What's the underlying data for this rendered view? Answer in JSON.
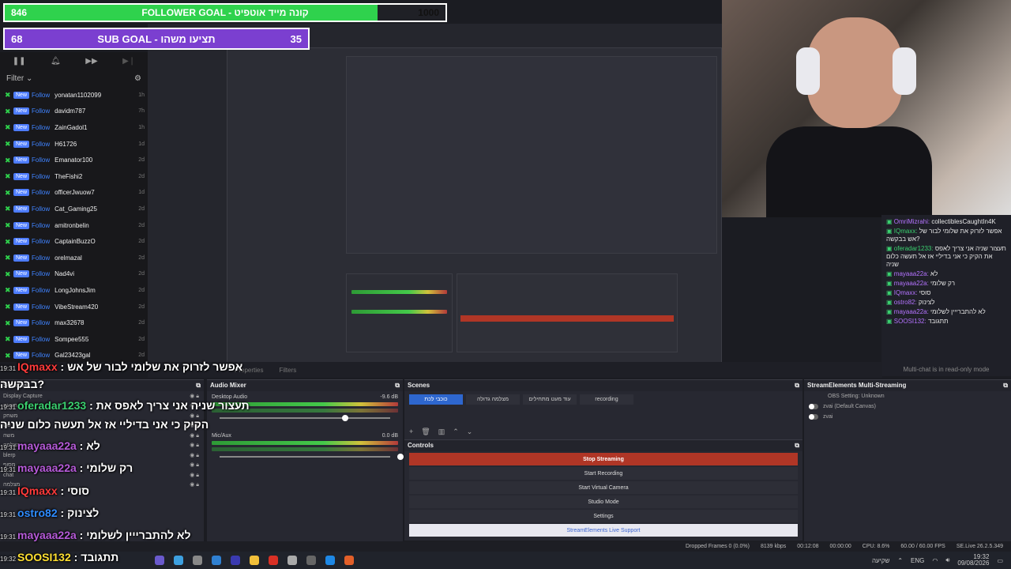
{
  "goals": {
    "follower": {
      "current": "846",
      "title": "FOLLOWER GOAL - קונה מייד אוטפיט",
      "target": "1000",
      "progress": 0.846
    },
    "sub": {
      "current": "68",
      "title": "SUB GOAL - תציעו משהו",
      "target": "35"
    }
  },
  "feed": {
    "filter_label": "Filter",
    "new_label": "New",
    "follow_label": "Follow",
    "rows": [
      {
        "name": "yonatan1102099",
        "age": "1h"
      },
      {
        "name": "davidm787",
        "age": "7h"
      },
      {
        "name": "ZainGadol1",
        "age": "1h"
      },
      {
        "name": "H61726",
        "age": "1d"
      },
      {
        "name": "Emanator100",
        "age": "2d"
      },
      {
        "name": "TheFishi2",
        "age": "2d"
      },
      {
        "name": "officerJwuow7",
        "age": "1d"
      },
      {
        "name": "Cat_Gaming25",
        "age": "2d"
      },
      {
        "name": "amitronbelin",
        "age": "2d"
      },
      {
        "name": "CaptainBuzzO",
        "age": "2d"
      },
      {
        "name": "orelmazal",
        "age": "2d"
      },
      {
        "name": "Nad4vi",
        "age": "2d"
      },
      {
        "name": "LongJohnsJim",
        "age": "2d"
      },
      {
        "name": "VibeStream420",
        "age": "2d"
      },
      {
        "name": "max32678",
        "age": "2d"
      },
      {
        "name": "Sompee555",
        "age": "2d"
      },
      {
        "name": "Gal23423gal",
        "age": "2d"
      }
    ]
  },
  "chat": {
    "lines": [
      {
        "user": "OmriMizrahi:",
        "text": "collectiblesCaughtIn4K",
        "color": "purple"
      },
      {
        "user": "IQmaxx:",
        "text": "אפשר לזרוק את שלומי לבור של אש בבקשה?",
        "color": "green"
      },
      {
        "user": "oferadar1233:",
        "text": "תעצור שניה אני צריך לאפס את הקיק כי אני בדיליי אז אל תעשה כלום שניה",
        "color": "green"
      },
      {
        "user": "mayaaa22a:",
        "text": "לא",
        "color": "purple"
      },
      {
        "user": "mayaaa22a:",
        "text": "רק שלומי",
        "color": "purple"
      },
      {
        "user": "IQmaxx:",
        "text": "סוסי",
        "color": "purple"
      },
      {
        "user": "ostro82:",
        "text": "לצינוק",
        "color": "purple"
      },
      {
        "user": "mayaaa22a:",
        "text": "לא להתברייין לשלומי",
        "color": "purple"
      },
      {
        "user": "SOOSI132:",
        "text": "תתגובד",
        "color": "purple"
      }
    ],
    "footer": "Multi-chat is in read-only mode"
  },
  "overlay_chat": [
    {
      "time": "19:31",
      "user": "IQmaxx",
      "text": ": אפשר לזרוק את שלומי לבור של אש",
      "cls": "u-r"
    },
    {
      "time": "",
      "user": "",
      "text": "בבקשה?",
      "cls": ""
    },
    {
      "time": "19:31",
      "user": "oferadar1233",
      "text": ": תעצור שניה אני צריך לאפס את",
      "cls": "u-g"
    },
    {
      "time": "",
      "user": "",
      "text": "הקיק כי אני בדיליי אז אל תעשה כלום שניה",
      "cls": ""
    },
    {
      "time": "19:31",
      "user": "mayaaa22a",
      "text": ": לא",
      "cls": "u-p"
    },
    {
      "time": "19:31",
      "user": "mayaaa22a",
      "text": ": רק שלומי",
      "cls": "u-p"
    },
    {
      "time": "19:31",
      "user": "IQmaxx",
      "text": ": סוסי",
      "cls": "u-r"
    },
    {
      "time": "19:31",
      "user": "ostro82",
      "text": ": לצינוק",
      "cls": "u-b"
    },
    {
      "time": "19:31",
      "user": "mayaaa22a",
      "text": ": לא להתברייין לשלומי",
      "cls": "u-p"
    },
    {
      "time": "19:32",
      "user": "SOOSI132",
      "text": ": תתגובד",
      "cls": "u-y"
    }
  ],
  "obs": {
    "toolbar": {
      "properties": "Properties",
      "filters": "Filters"
    },
    "sources": {
      "title": "Sources",
      "items": [
        "Display Capture",
        "תצוגה",
        "משחק",
        "שם",
        "משה",
        "מצלמה",
        "blerp",
        "מסוף",
        "chat",
        "מצלמה"
      ]
    },
    "mixer": {
      "title": "Audio Mixer",
      "tracks": [
        {
          "name": "Desktop Audio",
          "db": "-9.6 dB"
        },
        {
          "name": "Mic/Aux",
          "db": "0.0 dB"
        }
      ]
    },
    "scenes": {
      "title": "Scenes",
      "tabs": [
        "כוכבי לכת",
        "מצלמה גדולה",
        "עוד מעט מתחילים",
        "recording"
      ]
    },
    "controls": {
      "title": "Controls",
      "buttons": [
        "Stop Streaming",
        "Start Recording",
        "Start Virtual Camera",
        "Studio Mode",
        "Settings",
        "StreamElements Live Support"
      ]
    },
    "multi": {
      "title": "StreamElements Multi-Streaming",
      "status": "OBS Setting: Unknown",
      "rows": [
        "zvai (Default Canvas)",
        "zvai"
      ]
    },
    "status": {
      "dropped": "Dropped Frames 0 (0.0%)",
      "kbps": "8139 kbps",
      "live": "00:12:08",
      "rec": "00:00:00",
      "cpu": "CPU: 8.6%",
      "fps": "60.00 / 60.00 FPS",
      "version": "SE.Live 26.2.5.349"
    }
  },
  "taskbar": {
    "lang": "ENG",
    "weather": "שקיעה",
    "time": "19:32",
    "date": "09/08/2026"
  },
  "colors": {
    "follower_fill": "#2fd24d",
    "sub_bg": "#7b3fd0",
    "stop_red": "#b03626"
  }
}
